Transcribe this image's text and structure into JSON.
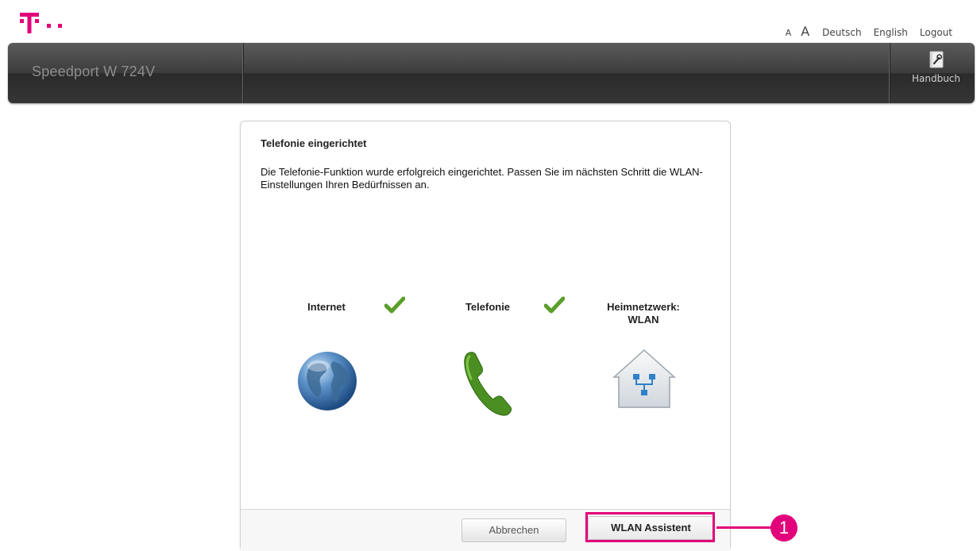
{
  "brand": {
    "color": "#e2007a"
  },
  "toplinks": {
    "font_small": "A",
    "font_large": "A",
    "lang_de": "Deutsch",
    "lang_en": "English",
    "logout": "Logout"
  },
  "navbar": {
    "title": "Speedport W 724V",
    "handbuch_label": "Handbuch",
    "handbuch_icon": "manual-wrench-icon"
  },
  "panel": {
    "title": "Telefonie eingerichtet",
    "description": "Die Telefonie-Funktion wurde erfolgreich eingerichtet. Passen Sie im nächsten Schritt die WLAN-Einstellungen Ihren Bedürfnissen an.",
    "steps": [
      {
        "label": "Internet",
        "status": "done",
        "icon": "globe-icon"
      },
      {
        "label": "Telefonie",
        "status": "done",
        "icon": "phone-icon"
      },
      {
        "label_line1": "Heimnetzwerk:",
        "label_line2": "WLAN",
        "status": "pending",
        "icon": "home-network-icon"
      }
    ],
    "buttons": {
      "cancel": "Abbrechen",
      "primary": "WLAN Assistent"
    }
  },
  "annotation": {
    "number": "1"
  }
}
